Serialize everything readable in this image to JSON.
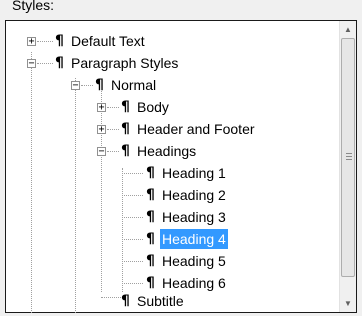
{
  "panel": {
    "label": "Styles:",
    "tree": [
      {
        "key": "default_text",
        "label": "Default Text",
        "expander": "+"
      },
      {
        "key": "paragraph_styles",
        "label": "Paragraph Styles",
        "expander": "−"
      },
      {
        "key": "normal",
        "label": "Normal",
        "expander": "−"
      },
      {
        "key": "body",
        "label": "Body",
        "expander": "+"
      },
      {
        "key": "header_footer",
        "label": "Header and Footer",
        "expander": "+"
      },
      {
        "key": "headings",
        "label": "Headings",
        "expander": "−"
      },
      {
        "key": "heading_1",
        "label": "Heading 1"
      },
      {
        "key": "heading_2",
        "label": "Heading 2"
      },
      {
        "key": "heading_3",
        "label": "Heading 3"
      },
      {
        "key": "heading_4",
        "label": "Heading 4",
        "selected": true
      },
      {
        "key": "heading_5",
        "label": "Heading 5"
      },
      {
        "key": "heading_6",
        "label": "Heading 6"
      },
      {
        "key": "subtitle",
        "label": "Subtitle"
      }
    ],
    "style_glyph": "¶",
    "scroll_up_glyph": "▲",
    "scroll_down_glyph": "▼",
    "icons": {
      "style": "pilcrow-icon",
      "expand": "expand-icon",
      "collapse": "collapse-icon",
      "scroll_up": "arrow-up-icon",
      "scroll_down": "arrow-down-icon"
    },
    "colors": {
      "selection_bg": "#3399ff",
      "selection_text": "#ffffff",
      "tree_lines": "#a0a0a0"
    }
  }
}
